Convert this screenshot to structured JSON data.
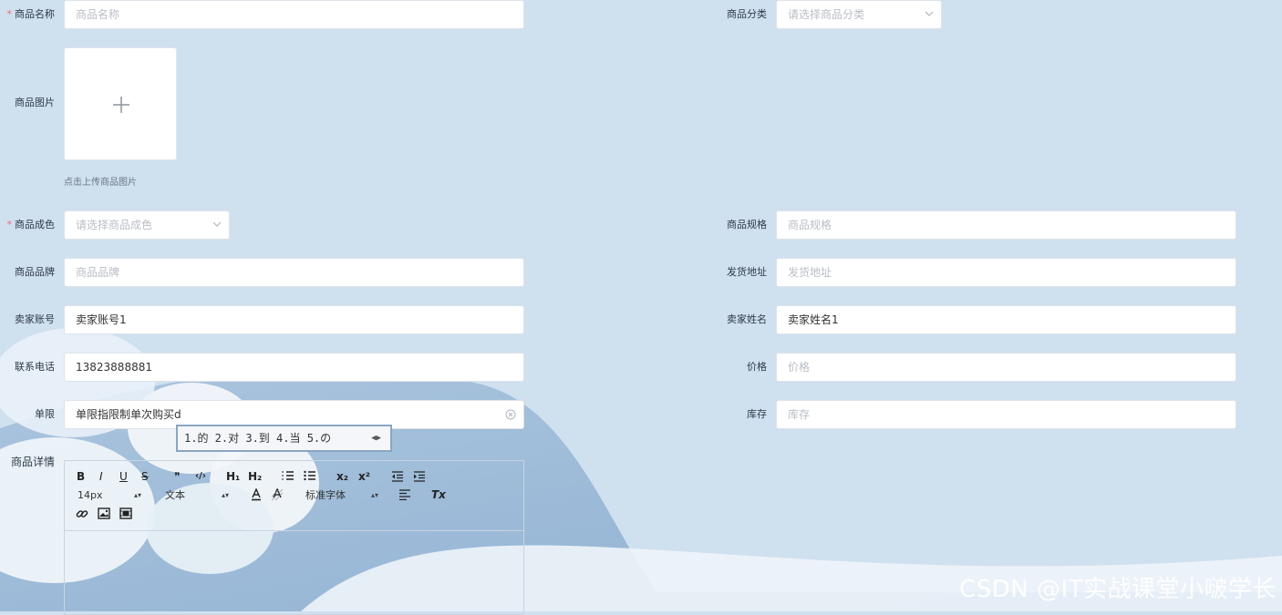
{
  "form": {
    "name": {
      "label": "商品名称",
      "placeholder": "商品名称",
      "required": true
    },
    "category": {
      "label": "商品分类",
      "placeholder": "请选择商品分类"
    },
    "image": {
      "label": "商品图片",
      "hint": "点击上传商品图片"
    },
    "condition": {
      "label": "商品成色",
      "placeholder": "请选择商品成色",
      "required": true
    },
    "spec": {
      "label": "商品规格",
      "placeholder": "商品规格"
    },
    "brand": {
      "label": "商品品牌",
      "placeholder": "商品品牌"
    },
    "address": {
      "label": "发货地址",
      "placeholder": "发货地址"
    },
    "seller_account": {
      "label": "卖家账号",
      "value": "卖家账号1"
    },
    "seller_name": {
      "label": "卖家姓名",
      "value": "卖家姓名1"
    },
    "phone": {
      "label": "联系电话",
      "value": "13823888881"
    },
    "price": {
      "label": "价格",
      "placeholder": "价格"
    },
    "limit": {
      "label": "单限",
      "value": "单限指限制单次购买d"
    },
    "stock": {
      "label": "库存",
      "placeholder": "库存"
    },
    "detail": {
      "label": "商品详情"
    }
  },
  "ime": {
    "candidates": "1.的  2.对  3.到  4.当  5.の",
    "arrows": "◀▶"
  },
  "editor": {
    "bold": "B",
    "italic": "I",
    "underline": "U",
    "strike": "S",
    "quote": "❞",
    "code": "‹/›",
    "h1": "H₁",
    "h2": "H₂",
    "sub": "x₂",
    "sup": "x²",
    "size_value": "14px",
    "header_value": "文本",
    "font_value": "标准字体",
    "clean": "Tx"
  },
  "watermark": "CSDN @IT实战课堂小啵学长"
}
